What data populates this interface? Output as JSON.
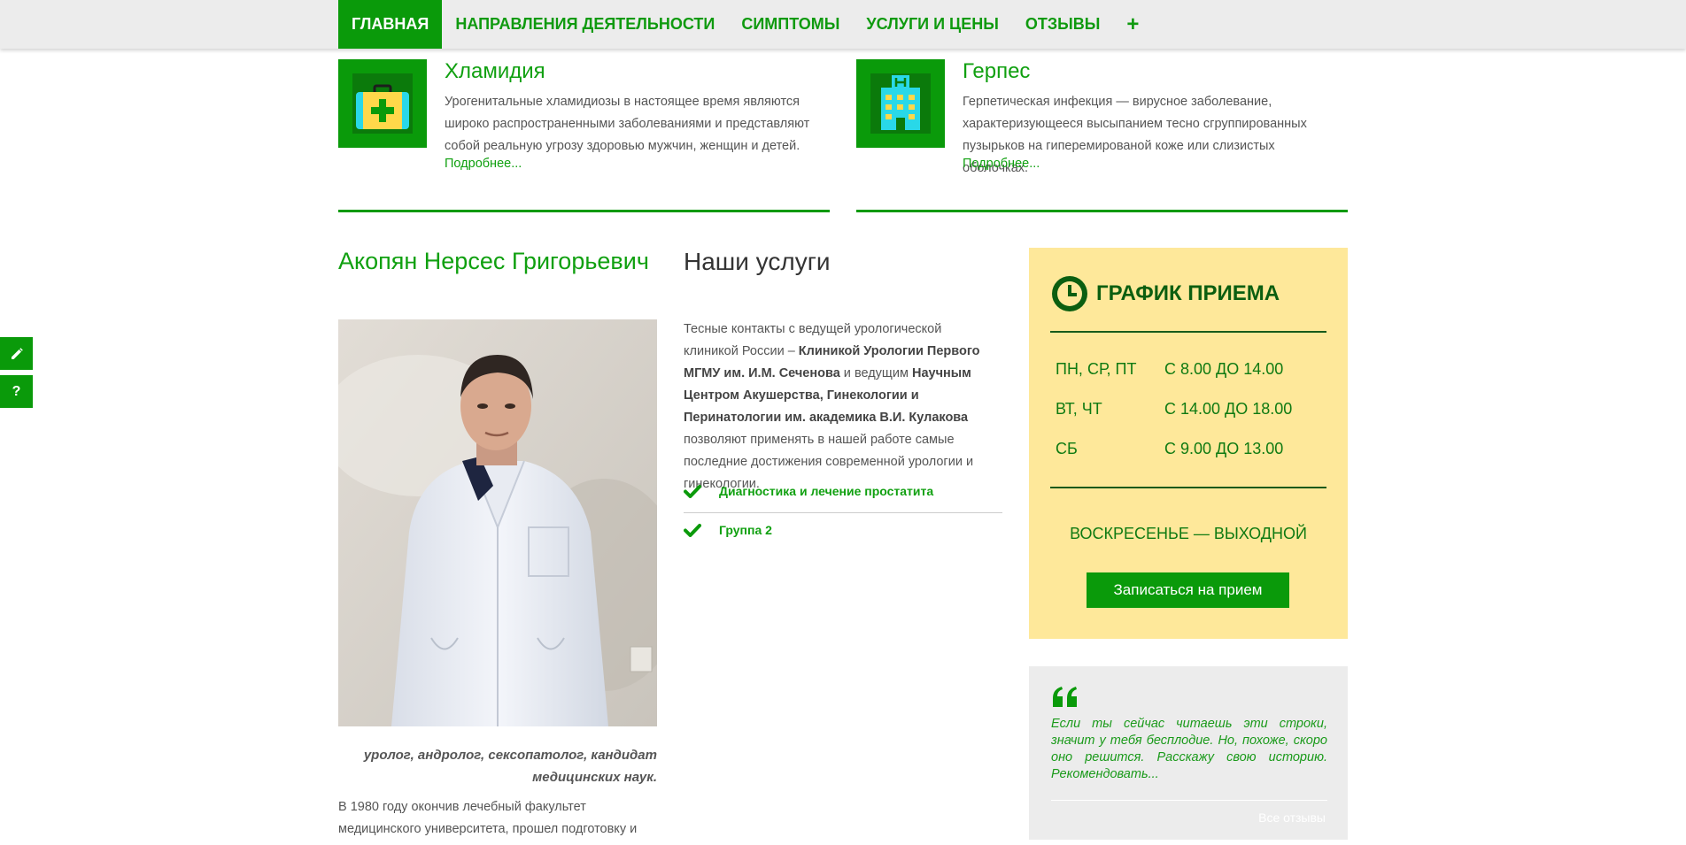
{
  "nav": {
    "items": [
      "ГЛАВНАЯ",
      "НАПРАВЛЕНИЯ ДЕЯТЕЛЬНОСТИ",
      "СИМПТОМЫ",
      "УСЛУГИ И ЦЕНЫ",
      "ОТЗЫВЫ"
    ],
    "more": "+"
  },
  "side_tools": {
    "help": "?"
  },
  "features": [
    {
      "title": "Хламидия",
      "text": "Урогенитальные хламидиозы в настоящее время являются широко распространенными заболеваниями и представляют собой реальную угрозу здоровью мужчин, женщин и детей.",
      "more": "Подробнее..."
    },
    {
      "title": "Герпес",
      "text": "Герпетическая инфекция — вирусное заболевание, характеризующееся высыпанием тесно сгруппированных пузырьков на гиперемированой коже или слизистых оболочках.",
      "more": "Подробнее..."
    }
  ],
  "doctor": {
    "name": "Акопян Нерсес Григорьевич",
    "title": "уролог, андролог, сексопатолог, кандидат медицинских наук.",
    "bio": "В 1980 году окончив лечебный факультет медицинского университета, прошел подготовку и"
  },
  "services": {
    "heading": "Наши услуги",
    "p1": "Тесные контакты с ведущей урологической клиникой России – ",
    "b1": "Клиникой Урологии Первого МГМУ им. И.М. Сеченова",
    "p2": " и ведущим ",
    "b2": "Научным Центром Акушерства, Гинекологии и Перинатологии им. академика В.И. Кулакова",
    "p3": " позволяют применять в нашей работе самые последние достижения современной урологии и гинекологии.",
    "items": [
      "Диагностика и лечение простатита",
      "Группа 2"
    ]
  },
  "schedule": {
    "title": "ГРАФИК ПРИЕМА",
    "rows": [
      {
        "days": "ПН, СР, ПТ",
        "time": "С 8.00 ДО 14.00"
      },
      {
        "days": "ВТ, ЧТ",
        "time": "С 14.00 ДО 18.00"
      },
      {
        "days": "СБ",
        "time": "С 9.00 ДО 13.00"
      }
    ],
    "day_off": "ВОСКРЕСЕНЬЕ — ВЫХОДНОЙ",
    "button": "Записаться на прием"
  },
  "review": {
    "text": "Если ты сейчас читаешь эти строки, значит у тебя бесплодие. Но, похоже, скоро оно решится. Расскажу свою историю. Рекомендовать...",
    "all_link": "Все отзывы"
  },
  "colors": {
    "brand_green": "#0a9a0a",
    "text_green": "#10a010",
    "schedule_bg": "#fee89a",
    "schedule_text": "#0f7a12",
    "nav_bg": "#ececec"
  }
}
